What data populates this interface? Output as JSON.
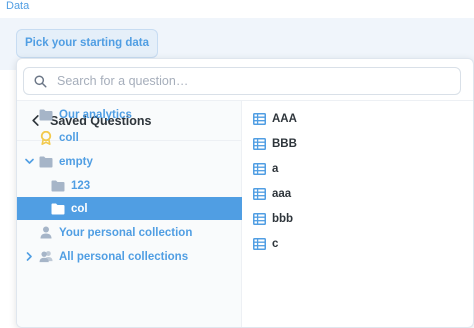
{
  "section": {
    "label": "Data"
  },
  "picker": {
    "button_label": "Pick your starting data"
  },
  "search": {
    "placeholder": "Search for a question…",
    "value": ""
  },
  "saved": {
    "header": "Saved Questions"
  },
  "collections": [
    {
      "label": "Our analytics",
      "icon": "folder-icon",
      "expandable": false,
      "expanded": false,
      "selected": false
    },
    {
      "label": "coll",
      "icon": "badge-icon",
      "expandable": false,
      "expanded": false,
      "selected": false
    },
    {
      "label": "empty",
      "icon": "folder-icon",
      "expandable": true,
      "expanded": true,
      "selected": false
    },
    {
      "label": "123",
      "icon": "folder-icon",
      "expandable": false,
      "expanded": false,
      "selected": false
    },
    {
      "label": "col",
      "icon": "folder-icon",
      "expandable": false,
      "expanded": false,
      "selected": true
    },
    {
      "label": "Your personal collection",
      "icon": "person-icon",
      "expandable": false,
      "expanded": false,
      "selected": false
    },
    {
      "label": "All personal collections",
      "icon": "people-icon",
      "expandable": true,
      "expanded": false,
      "selected": false
    }
  ],
  "questions": [
    {
      "label": "AAA",
      "icon": "table-icon"
    },
    {
      "label": "BBB",
      "icon": "table-icon"
    },
    {
      "label": "a",
      "icon": "table-icon"
    },
    {
      "label": "aaa",
      "icon": "table-icon"
    },
    {
      "label": "bbb",
      "icon": "table-icon"
    },
    {
      "label": "c",
      "icon": "table-icon"
    }
  ],
  "colors": {
    "brand": "#509ee3",
    "text_dark": "#2e353b",
    "icon_muted": "#a6b5c8",
    "selected_bg": "#509ee3"
  }
}
